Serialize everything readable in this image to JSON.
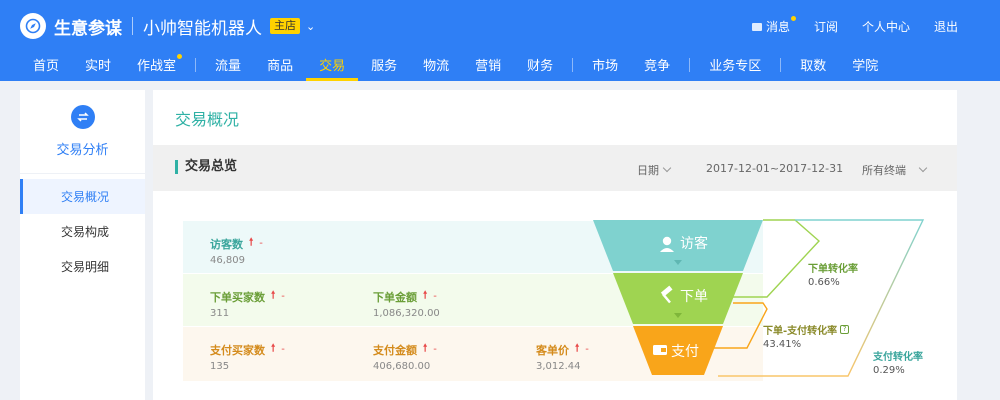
{
  "header": {
    "brand": "生意参谋",
    "shop_name": "小帅智能机器人",
    "shop_badge": "主店",
    "links": {
      "messages": "消息",
      "subscribe": "订阅",
      "profile": "个人中心",
      "logout": "退出"
    },
    "accent": "#2f7ff5",
    "highlight": "#ffd200"
  },
  "nav": {
    "home": "首页",
    "realtime": "实时",
    "warroom": "作战室",
    "traffic": "流量",
    "product": "商品",
    "trade": "交易",
    "service": "服务",
    "logistics": "物流",
    "marketing": "营销",
    "finance": "财务",
    "market": "市场",
    "compete": "竞争",
    "zone": "业务专区",
    "fetch": "取数",
    "academy": "学院"
  },
  "sidebar": {
    "title": "交易分析",
    "items": [
      {
        "label": "交易概况"
      },
      {
        "label": "交易构成"
      },
      {
        "label": "交易明细"
      }
    ]
  },
  "main": {
    "title": "交易概况",
    "summary_title": "交易总览",
    "date_label": "日期",
    "date_range": "2017-12-01~2017-12-31",
    "terminal": "所有终端"
  },
  "funnel": {
    "visitors": {
      "label": "访客数",
      "value": "46,809",
      "stage": "访客",
      "trend": "-"
    },
    "buyers": {
      "label": "下单买家数",
      "value": "311",
      "trend": "-"
    },
    "order_amount": {
      "label": "下单金额",
      "value": "1,086,320.00",
      "trend": "-"
    },
    "order_stage": "下单",
    "pay_buyers": {
      "label": "支付买家数",
      "value": "135",
      "trend": "-"
    },
    "pay_amount": {
      "label": "支付金额",
      "value": "406,680.00",
      "trend": "-"
    },
    "unit_price": {
      "label": "客单价",
      "value": "3,012.44",
      "trend": "-"
    },
    "pay_stage": "支付",
    "rates": {
      "order_rate": {
        "label": "下单转化率",
        "value": "0.66%"
      },
      "order_pay_rate": {
        "label": "下单-支付转化率",
        "value": "43.41%"
      },
      "pay_rate": {
        "label": "支付转化率",
        "value": "0.29%"
      }
    },
    "colors": {
      "visit": "#7fd2cf",
      "order": "#9fd451",
      "pay": "#f9a51a"
    }
  }
}
